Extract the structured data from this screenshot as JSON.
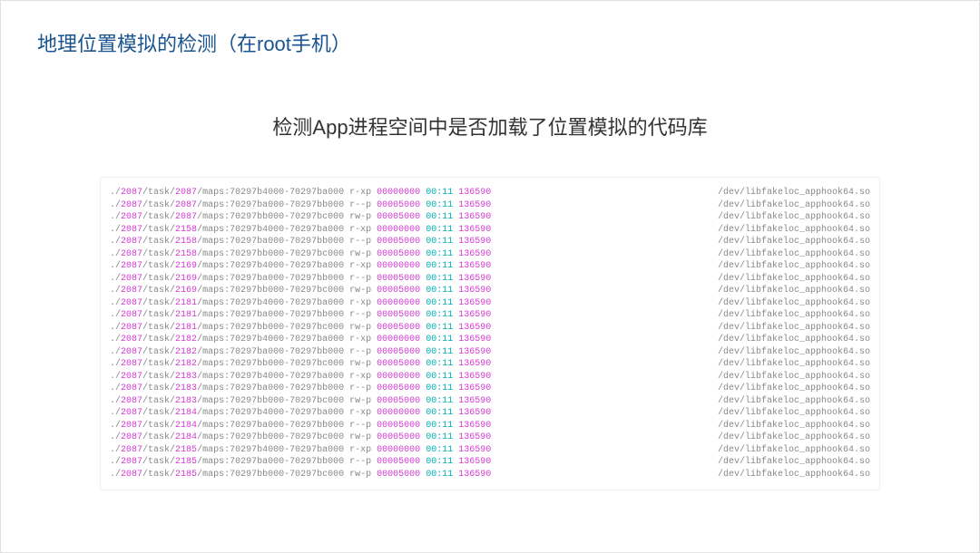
{
  "title": "地理位置模拟的检测（在root手机）",
  "subtitle": "检测App进程空间中是否加载了位置模拟的代码库",
  "code": {
    "pid_main": "2087",
    "dev": "00:11",
    "inode": "136590",
    "lib_path": "/dev/libfakeloc_apphook64.so",
    "addr_r_xp": "70297b4000-70297ba000",
    "addr_r_p": "70297ba000-70297bb000",
    "addr_rw_p": "70297bb000-70297bc000",
    "perm_r_xp": "r-xp",
    "perm_r_p": "r--p",
    "perm_rw_p": "rw-p",
    "offset_0": "00000000",
    "offset_5": "00005000",
    "tasks": [
      {
        "tid": "2087"
      },
      {
        "tid": "2158"
      },
      {
        "tid": "2169"
      },
      {
        "tid": "2181"
      },
      {
        "tid": "2182"
      },
      {
        "tid": "2183"
      },
      {
        "tid": "2184"
      },
      {
        "tid": "2185"
      }
    ]
  }
}
